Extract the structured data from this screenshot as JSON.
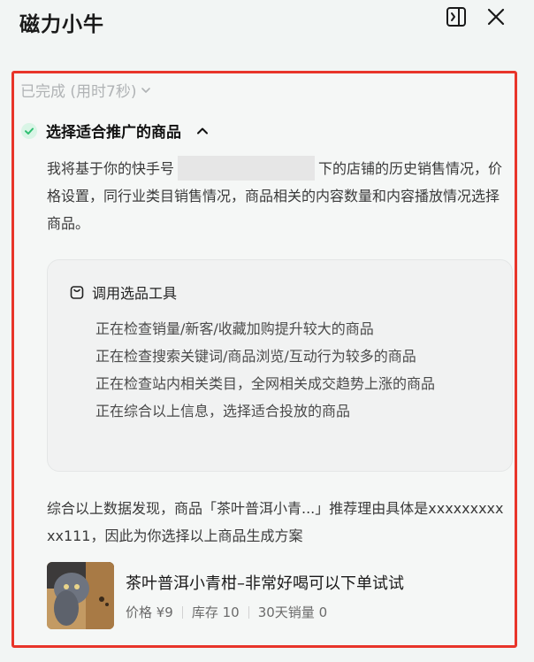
{
  "header": {
    "title": "磁力小牛"
  },
  "status": {
    "done_label": "已完成 (用时7秒)"
  },
  "step": {
    "title": "选择适合推广的商品",
    "intro_prefix": "我将基于你的快手号",
    "intro_suffix": "下的店铺的历史销售情况，价格设置，同行业类目销售情况，商品相关的内容数量和内容播放情况选择商品。"
  },
  "tool": {
    "title": "调用选品工具",
    "steps": [
      "正在检查销量/新客/收藏加购提升较大的商品",
      "正在检查搜索关键词/商品浏览/互动行为较多的商品",
      "正在检查站内相关类目，全网相关成交趋势上涨的商品",
      "正在综合以上信息，选择适合投放的商品"
    ]
  },
  "summary": {
    "text": "综合以上数据发现，商品「茶叶普洱小青...」推荐理由具体是xxxxxxxxxxx111，因此为你选择以上商品生成方案"
  },
  "product": {
    "name": "茶叶普洱小青柑–非常好喝可以下单试试",
    "price": "价格 ¥9",
    "stock": "库存 10",
    "sales": "30天销量 0"
  },
  "colors": {
    "highlight_border": "#e8352a",
    "check_green": "#2fbf71"
  }
}
